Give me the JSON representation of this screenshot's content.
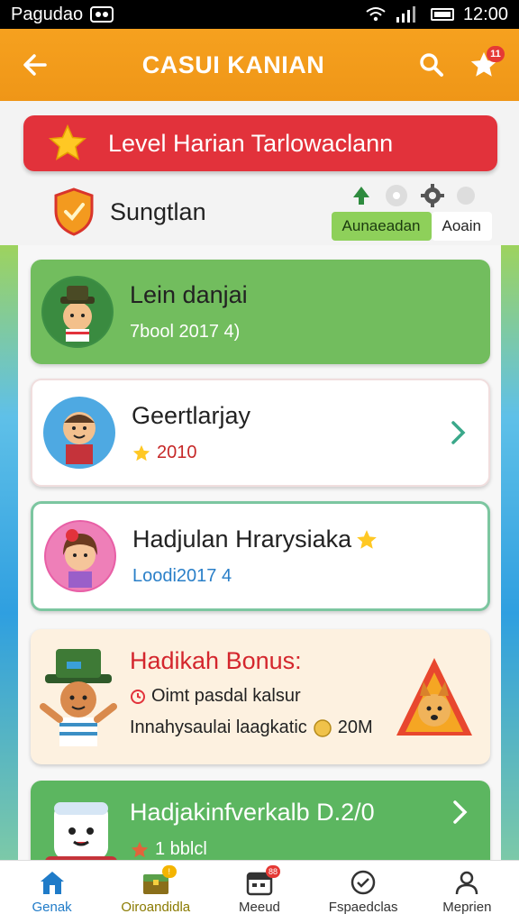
{
  "status_bar": {
    "left_text": "Pagudao",
    "time": "12:00"
  },
  "app_bar": {
    "title": "CASUI KANIAN",
    "notification_count": "11"
  },
  "level_banner": {
    "text": "Level Harian Tarlowaclann"
  },
  "profile": {
    "name": "Sungtlan",
    "toggle_option_a": "Aunaeadan",
    "toggle_option_b": "Aoain"
  },
  "cards": [
    {
      "title": "Lein danjai",
      "subtitle": "7bool 2017 4)"
    },
    {
      "title": "Geertlarjay",
      "subtitle": "2010"
    },
    {
      "title": "Hadjulan Hrarysiaka",
      "subtitle": "Loodi2017 4"
    },
    {
      "title": "Hadikah Bonus:",
      "line1": "Oimt pasdal kalsur",
      "line2": "Innahysaulai laagkatic",
      "line2_value": "20M"
    },
    {
      "title": "Hadjakinfverkalb D.2/0",
      "subtitle": "1 bblcl"
    }
  ],
  "bottom_nav": [
    {
      "label": "Genak"
    },
    {
      "label": "Oiroandidla",
      "badge": "!"
    },
    {
      "label": "Meeud",
      "badge": "88"
    },
    {
      "label": "Fspaedclas"
    },
    {
      "label": "Meprien"
    }
  ],
  "colors": {
    "app_bar": "#f6a11f",
    "banner_red": "#e2323b",
    "green_card": "#72bd5e",
    "bonus_red": "#d4262d",
    "nav_active": "#1f7bc8"
  }
}
